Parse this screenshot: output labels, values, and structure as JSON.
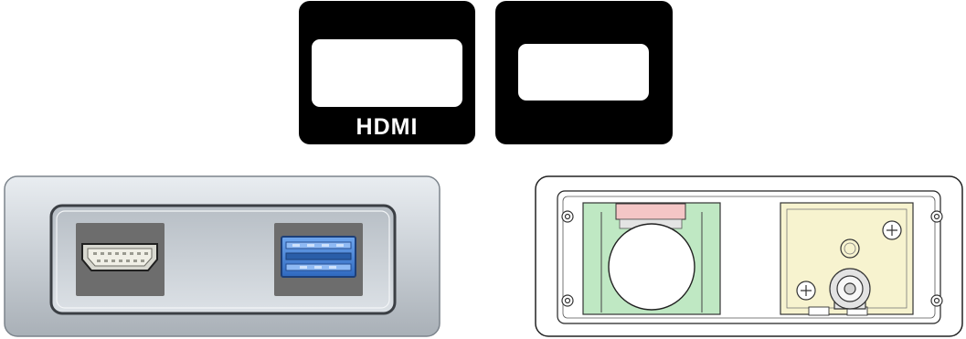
{
  "labels": {
    "hdmi_plate_text": "HDMI"
  },
  "colors": {
    "plate_black": "#000000",
    "panel_silver": "#c9cfd5",
    "port_backing_gray": "#6d6d6d",
    "usb3_blue": "#3f7fd6",
    "green_module": "#bfe8c3",
    "yellow_module": "#f7f3cf",
    "pink_tab": "#f4c6c6"
  },
  "icons": {
    "hdmi_port": "hdmi-port-icon",
    "usb3_port": "usb3-port-icon",
    "screw_head": "phillips-screw-icon"
  }
}
